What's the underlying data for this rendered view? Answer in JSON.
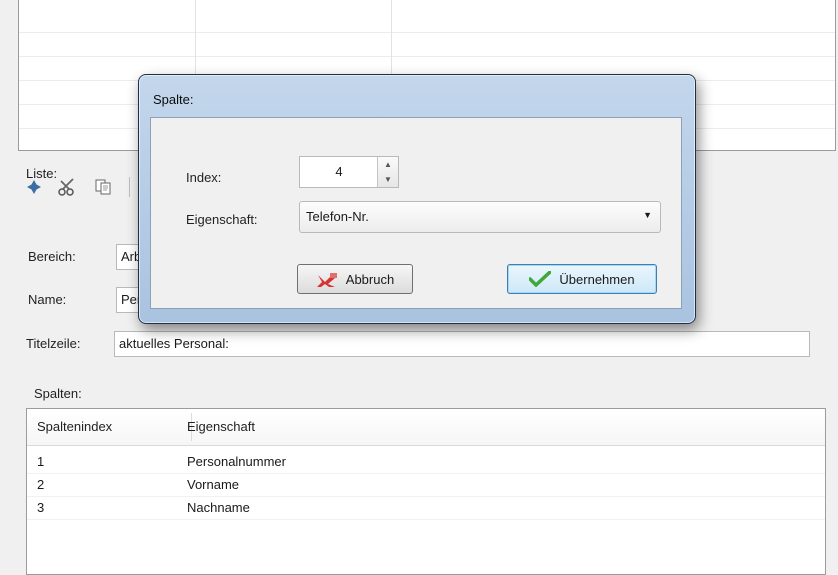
{
  "liste": {
    "label": "Liste:",
    "bereich_label": "Bereich:",
    "bereich_value": "Arb",
    "name_label": "Name:",
    "name_value": "Per",
    "titelzeile_label": "Titelzeile:",
    "titelzeile_value": "aktuelles Personal:"
  },
  "toolbar": {
    "icons": [
      "add-icon",
      "cut-icon",
      "copy-icon",
      "paste-icon"
    ]
  },
  "spalten": {
    "label": "Spalten:",
    "columns": [
      "Spaltenindex",
      "Eigenschaft"
    ],
    "rows": [
      {
        "index": "1",
        "eigenschaft": "Personalnummer"
      },
      {
        "index": "2",
        "eigenschaft": "Vorname"
      },
      {
        "index": "3",
        "eigenschaft": "Nachname"
      }
    ]
  },
  "dialog": {
    "title": "Spalte:",
    "index_label": "Index:",
    "index_value": "4",
    "eigenschaft_label": "Eigenschaft:",
    "eigenschaft_value": "Telefon-Nr.",
    "cancel_label": "Abbruch",
    "ok_label": "Übernehmen"
  },
  "colors": {
    "dialog_frame": "#b7cde6",
    "cancel_icon": "#d63333",
    "ok_icon": "#3fa83a"
  }
}
